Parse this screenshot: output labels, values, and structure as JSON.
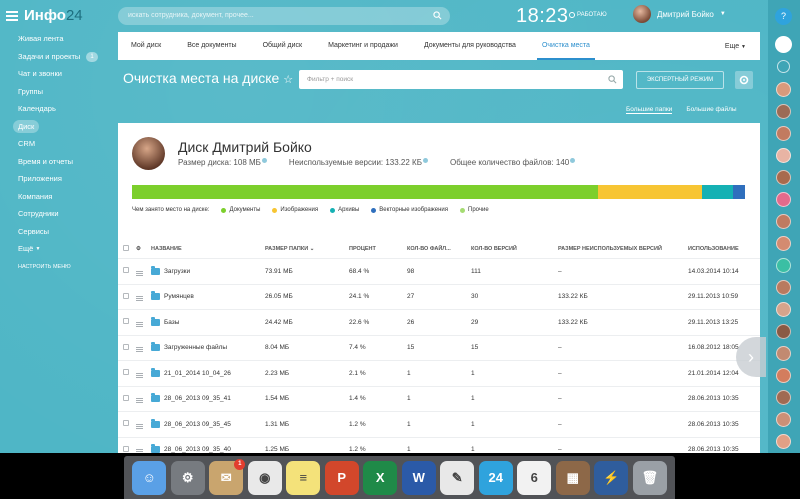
{
  "header": {
    "logo_text": "Инфо",
    "logo_num": "24",
    "search_placeholder": "искать сотрудника, документ, прочее...",
    "clock": "18:23",
    "work_status": "РАБОТАЮ",
    "user_name": "Дмитрий Бойко"
  },
  "sidebar": {
    "items": [
      {
        "label": "Живая лента"
      },
      {
        "label": "Задачи и проекты",
        "badge": "1"
      },
      {
        "label": "Чат и звонки"
      },
      {
        "label": "Группы"
      },
      {
        "label": "Календарь"
      },
      {
        "label": "Диск",
        "active": true
      },
      {
        "label": "CRM"
      },
      {
        "label": "Время и отчеты"
      },
      {
        "label": "Приложения"
      },
      {
        "label": "Компания"
      },
      {
        "label": "Сотрудники"
      },
      {
        "label": "Сервисы"
      },
      {
        "label": "Ещё"
      }
    ],
    "settings_label": "НАСТРОИТЬ МЕНЮ"
  },
  "tabs": {
    "items": [
      "Мой диск",
      "Все документы",
      "Общий диск",
      "Маркетинг и продажи",
      "Документы для руководства",
      "Очистка места"
    ],
    "active": "Очистка места",
    "more": "Еще"
  },
  "toolbar": {
    "page_title": "Очистка места на диске",
    "filter_placeholder": "Фильтр + поиск",
    "expert_mode": "ЭКСПЕРТНЫЙ РЕЖИМ",
    "view_large": "Большие папки",
    "view_files": "Большие файлы"
  },
  "disk": {
    "title": "Диск Дмитрий Бойко",
    "size_label": "Размер диска: 108 МБ",
    "unused_label": "Неиспользуемые версии: 133.22 КБ",
    "count_label": "Общее количество файлов: 140",
    "usage_label": "Чем занято место на диске:",
    "usage": [
      {
        "name": "Документы",
        "color": "#7ccf2c",
        "share": 0.76
      },
      {
        "name": "Изображения",
        "color": "#f7c533",
        "share": 0.17
      },
      {
        "name": "Архивы",
        "color": "#15b1b4",
        "share": 0.05
      },
      {
        "name": "Векторные изображения",
        "color": "#2f6fbd",
        "share": 0.02
      },
      {
        "name": "Прочие",
        "color": "#a5dc72",
        "share": 0
      }
    ]
  },
  "table": {
    "headers": [
      "НАЗВАНИЕ",
      "РАЗМЕР ПАПКИ",
      "ПРОЦЕНТ",
      "КОЛ-ВО ФАЙЛ...",
      "КОЛ-ВО ВЕРСИЙ",
      "РАЗМЕР НЕИСПОЛЬЗУЕМЫХ ВЕРСИЙ",
      "ИСПОЛЬЗОВАНИЕ"
    ],
    "rows": [
      [
        "Загрузки",
        "73.91 МБ",
        "68.4 %",
        "98",
        "111",
        "–",
        "14.03.2014 10:14"
      ],
      [
        "Румянцев",
        "26.05 МБ",
        "24.1 %",
        "27",
        "30",
        "133.22 КБ",
        "29.11.2013 10:59"
      ],
      [
        "Базы",
        "24.42 МБ",
        "22.6 %",
        "26",
        "29",
        "133.22 КБ",
        "29.11.2013 13:25"
      ],
      [
        "Загруженные файлы",
        "8.04 МБ",
        "7.4 %",
        "15",
        "15",
        "–",
        "16.08.2012 18:05"
      ],
      [
        "21_01_2014 10_04_26",
        "2.23 МБ",
        "2.1 %",
        "1",
        "1",
        "–",
        "21.01.2014 12:04"
      ],
      [
        "28_06_2013 09_35_41",
        "1.54 МБ",
        "1.4 %",
        "1",
        "1",
        "–",
        "28.06.2013 10:35"
      ],
      [
        "28_06_2013 09_35_45",
        "1.31 МБ",
        "1.2 %",
        "1",
        "1",
        "–",
        "28.06.2013 10:35"
      ],
      [
        "28_06_2013 09_35_40",
        "1.25 МБ",
        "1.2 %",
        "1",
        "1",
        "–",
        "28.06.2013 10:35"
      ]
    ]
  },
  "dock": {
    "apps": [
      {
        "name": "finder",
        "color": "#5aa0e6",
        "glyph": "☺"
      },
      {
        "name": "system-preferences",
        "color": "#777b80",
        "glyph": "⚙"
      },
      {
        "name": "mail",
        "color": "#c9a56e",
        "glyph": "✉",
        "badge": "1"
      },
      {
        "name": "chrome",
        "color": "#e9e9e9",
        "glyph": "◉"
      },
      {
        "name": "notes",
        "color": "#f4e27a",
        "glyph": "≡"
      },
      {
        "name": "powerpoint",
        "color": "#d2472b",
        "glyph": "P"
      },
      {
        "name": "excel",
        "color": "#1f8a48",
        "glyph": "X"
      },
      {
        "name": "word",
        "color": "#2b5aa8",
        "glyph": "W"
      },
      {
        "name": "textedit",
        "color": "#e8e8e8",
        "glyph": "✎"
      },
      {
        "name": "bitrix24",
        "color": "#2fa3dd",
        "glyph": "24"
      },
      {
        "name": "calendar",
        "color": "#f2f2f2",
        "glyph": "6"
      },
      {
        "name": "calculator",
        "color": "#8d6848",
        "glyph": "▦"
      },
      {
        "name": "migration",
        "color": "#2f5d9d",
        "glyph": "⚡"
      },
      {
        "name": "trash",
        "color": "#9aa0a6",
        "glyph": "🗑"
      }
    ]
  }
}
